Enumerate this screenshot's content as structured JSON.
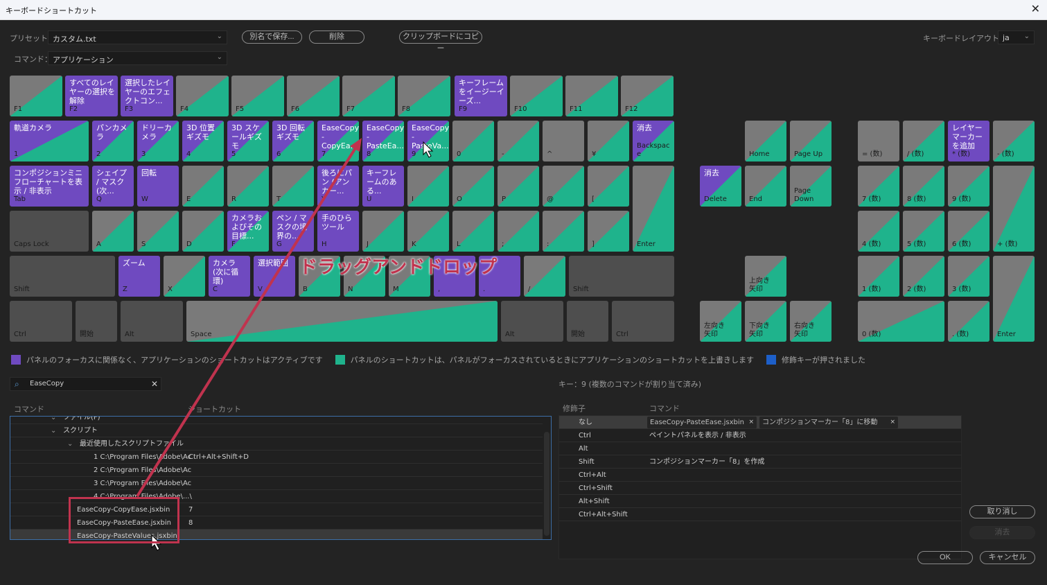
{
  "window": {
    "title": "キーボードショートカット",
    "close_icon": "✕"
  },
  "toolbar": {
    "preset_label": "プリセット：",
    "preset_value": "カスタム.txt",
    "command_label": "コマンド：",
    "command_value": "アプリケーション",
    "save_as_label": "別名で保存...",
    "delete_label": "削除",
    "copy_clipboard_label": "クリップボードにコピー",
    "layout_label": "キーボードレイアウト：",
    "layout_value": "ja"
  },
  "colors": {
    "app_shortcut": "#6f4ac0",
    "panel_shortcut": "#1fb38c",
    "modifier": "#1d5fc9",
    "unassigned": "#7a7a7a",
    "modifier_key": "#4e4e4e",
    "annotation": "#c0334e"
  },
  "keys": [
    {
      "id": "F1",
      "label": "F1",
      "cmd": "",
      "type": "split"
    },
    {
      "id": "F2",
      "label": "F2",
      "cmd": "すべてのレイヤーの選択を解除",
      "type": "app"
    },
    {
      "id": "F3",
      "label": "F3",
      "cmd": "選択したレイヤーのエフェクトコン...",
      "type": "app"
    },
    {
      "id": "F4",
      "label": "F4",
      "cmd": "",
      "type": "split"
    },
    {
      "id": "F5",
      "label": "F5",
      "cmd": "",
      "type": "split"
    },
    {
      "id": "F6",
      "label": "F6",
      "cmd": "",
      "type": "split"
    },
    {
      "id": "F7",
      "label": "F7",
      "cmd": "",
      "type": "split"
    },
    {
      "id": "F8",
      "label": "F8",
      "cmd": "",
      "type": "split"
    },
    {
      "id": "F9",
      "label": "F9",
      "cmd": "キーフレームをイージーイーズ...",
      "type": "app"
    },
    {
      "id": "F10",
      "label": "F10",
      "cmd": "",
      "type": "split"
    },
    {
      "id": "F11",
      "label": "F11",
      "cmd": "",
      "type": "split"
    },
    {
      "id": "F12",
      "label": "F12",
      "cmd": "",
      "type": "split"
    },
    {
      "id": "1",
      "label": "1",
      "cmd": "軌道カメラ",
      "type": "appsplit"
    },
    {
      "id": "2",
      "label": "2",
      "cmd": "パンカメラ",
      "type": "appsplit"
    },
    {
      "id": "3",
      "label": "3",
      "cmd": "ドリーカメラ",
      "type": "appsplit"
    },
    {
      "id": "4",
      "label": "4",
      "cmd": "3D 位置ギズモ",
      "type": "appsplit"
    },
    {
      "id": "5",
      "label": "5",
      "cmd": "3D スケールギズモ",
      "type": "appsplit"
    },
    {
      "id": "6",
      "label": "6",
      "cmd": "3D 回転ギズモ",
      "type": "appsplit"
    },
    {
      "id": "7",
      "label": "7",
      "cmd": "EaseCopy\n-\nCopyEa...",
      "type": "appsplit"
    },
    {
      "id": "8",
      "label": "8",
      "cmd": "EaseCopy\n-\nPasteEa...",
      "type": "appsplit"
    },
    {
      "id": "9",
      "label": "9",
      "cmd": "EaseCopy\n-\nPasteVa...",
      "type": "appsplit"
    },
    {
      "id": "0",
      "label": "0",
      "cmd": "",
      "type": "split"
    },
    {
      "id": "minus",
      "label": "-",
      "cmd": "",
      "type": "split"
    },
    {
      "id": "caret",
      "label": "^",
      "cmd": "",
      "type": "unassigned"
    },
    {
      "id": "yen",
      "label": "¥",
      "cmd": "",
      "type": "split"
    },
    {
      "id": "Backspace",
      "label": "Backspac\ne",
      "cmd": "消去",
      "type": "appsplit"
    },
    {
      "id": "Tab",
      "label": "Tab",
      "cmd": "コンポジションミニフローチャートを表示 / 非表示",
      "type": "app"
    },
    {
      "id": "Q",
      "label": "Q",
      "cmd": "シェイプ / マスク (次...",
      "type": "app"
    },
    {
      "id": "W",
      "label": "W",
      "cmd": "回転",
      "type": "app"
    },
    {
      "id": "E",
      "label": "E",
      "cmd": "",
      "type": "split"
    },
    {
      "id": "R",
      "label": "R",
      "cmd": "",
      "type": "split"
    },
    {
      "id": "T",
      "label": "T",
      "cmd": "",
      "type": "split"
    },
    {
      "id": "Y",
      "label": "Y",
      "cmd": "後ろにパン (アンカー...",
      "type": "app"
    },
    {
      "id": "U",
      "label": "U",
      "cmd": "キーフレームのある...",
      "type": "app"
    },
    {
      "id": "I",
      "label": "I",
      "cmd": "",
      "type": "split"
    },
    {
      "id": "O",
      "label": "O",
      "cmd": "",
      "type": "split"
    },
    {
      "id": "P",
      "label": "P",
      "cmd": "",
      "type": "split"
    },
    {
      "id": "at",
      "label": "@",
      "cmd": "",
      "type": "split"
    },
    {
      "id": "lbracket",
      "label": "[",
      "cmd": "",
      "type": "split"
    },
    {
      "id": "Enter",
      "label": "Enter",
      "cmd": "",
      "type": "split"
    },
    {
      "id": "CapsLock",
      "label": "Caps Lock",
      "cmd": "",
      "type": "modifier"
    },
    {
      "id": "A",
      "label": "A",
      "cmd": "",
      "type": "split"
    },
    {
      "id": "S",
      "label": "S",
      "cmd": "",
      "type": "split"
    },
    {
      "id": "D",
      "label": "D",
      "cmd": "",
      "type": "split"
    },
    {
      "id": "F",
      "label": "F",
      "cmd": "カメラおよびその目標...",
      "type": "appsplit"
    },
    {
      "id": "G",
      "label": "G",
      "cmd": "ペン / マスクの境界の...",
      "type": "app"
    },
    {
      "id": "H",
      "label": "H",
      "cmd": "手のひらツール",
      "type": "app"
    },
    {
      "id": "J",
      "label": "J",
      "cmd": "",
      "type": "split"
    },
    {
      "id": "K",
      "label": "K",
      "cmd": "",
      "type": "split"
    },
    {
      "id": "L",
      "label": "L",
      "cmd": "",
      "type": "split"
    },
    {
      "id": "semicolon",
      "label": ";",
      "cmd": "",
      "type": "split"
    },
    {
      "id": "colon",
      "label": ":",
      "cmd": "",
      "type": "split"
    },
    {
      "id": "rbracket",
      "label": "]",
      "cmd": "",
      "type": "split"
    },
    {
      "id": "ShiftL",
      "label": "Shift",
      "cmd": "",
      "type": "modifier"
    },
    {
      "id": "Z",
      "label": "Z",
      "cmd": "ズーム",
      "type": "app"
    },
    {
      "id": "X",
      "label": "X",
      "cmd": "",
      "type": "split"
    },
    {
      "id": "C",
      "label": "C",
      "cmd": "カメラ (次に循環)",
      "type": "app"
    },
    {
      "id": "V",
      "label": "V",
      "cmd": "選択範囲",
      "type": "app"
    },
    {
      "id": "B",
      "label": "B",
      "cmd": "",
      "type": "split"
    },
    {
      "id": "N",
      "label": "N",
      "cmd": "",
      "type": "split"
    },
    {
      "id": "M",
      "label": "M",
      "cmd": "",
      "type": "split"
    },
    {
      "id": "comma",
      "label": ",",
      "cmd": "",
      "type": "app"
    },
    {
      "id": "period",
      "label": ".",
      "cmd": "",
      "type": "app"
    },
    {
      "id": "slash",
      "label": "/",
      "cmd": "",
      "type": "split"
    },
    {
      "id": "ShiftR",
      "label": "Shift",
      "cmd": "",
      "type": "modifier"
    },
    {
      "id": "CtrlL",
      "label": "Ctrl",
      "cmd": "",
      "type": "modifier"
    },
    {
      "id": "WinL",
      "label": "開始",
      "cmd": "",
      "type": "modifier"
    },
    {
      "id": "AltL",
      "label": "Alt",
      "cmd": "",
      "type": "modifier"
    },
    {
      "id": "Space",
      "label": "Space",
      "cmd": "",
      "type": "split"
    },
    {
      "id": "AltR",
      "label": "Alt",
      "cmd": "",
      "type": "modifier"
    },
    {
      "id": "WinR",
      "label": "開始",
      "cmd": "",
      "type": "modifier"
    },
    {
      "id": "CtrlR",
      "label": "Ctrl",
      "cmd": "",
      "type": "modifier"
    },
    {
      "id": "Home",
      "label": "Home",
      "cmd": "",
      "type": "split"
    },
    {
      "id": "PageUp",
      "label": "Page Up",
      "cmd": "",
      "type": "split"
    },
    {
      "id": "Delete",
      "label": "Delete",
      "cmd": "消去",
      "type": "appsplit"
    },
    {
      "id": "End",
      "label": "End",
      "cmd": "",
      "type": "split"
    },
    {
      "id": "PageDown",
      "label": "Page\nDown",
      "cmd": "",
      "type": "split"
    },
    {
      "id": "Up",
      "label": "上向き\n矢印",
      "cmd": "",
      "type": "split"
    },
    {
      "id": "Left",
      "label": "左向き\n矢印",
      "cmd": "",
      "type": "split"
    },
    {
      "id": "Down",
      "label": "下向き\n矢印",
      "cmd": "",
      "type": "split"
    },
    {
      "id": "Right",
      "label": "右向き\n矢印",
      "cmd": "",
      "type": "split"
    },
    {
      "id": "NumEq",
      "label": "= (数)",
      "cmd": "",
      "type": "unassigned"
    },
    {
      "id": "NumDiv",
      "label": "/ (数)",
      "cmd": "",
      "type": "split"
    },
    {
      "id": "NumMul",
      "label": "* (数)",
      "cmd": "レイヤーマーカーを追加",
      "type": "app"
    },
    {
      "id": "NumSub",
      "label": "- (数)",
      "cmd": "",
      "type": "split"
    },
    {
      "id": "Num7",
      "label": "7 (数)",
      "cmd": "",
      "type": "split"
    },
    {
      "id": "Num8",
      "label": "8 (数)",
      "cmd": "",
      "type": "split"
    },
    {
      "id": "Num9",
      "label": "9 (数)",
      "cmd": "",
      "type": "split"
    },
    {
      "id": "NumAdd",
      "label": "+ (数)",
      "cmd": "",
      "type": "split"
    },
    {
      "id": "Num4",
      "label": "4 (数)",
      "cmd": "",
      "type": "split"
    },
    {
      "id": "Num5",
      "label": "5 (数)",
      "cmd": "",
      "type": "split"
    },
    {
      "id": "Num6",
      "label": "6 (数)",
      "cmd": "",
      "type": "split"
    },
    {
      "id": "Num1",
      "label": "1 (数)",
      "cmd": "",
      "type": "split"
    },
    {
      "id": "Num2",
      "label": "2 (数)",
      "cmd": "",
      "type": "split"
    },
    {
      "id": "Num3",
      "label": "3 (数)",
      "cmd": "",
      "type": "split"
    },
    {
      "id": "NumEnter",
      "label": "Enter",
      "cmd": "",
      "type": "split"
    },
    {
      "id": "Num0",
      "label": "0 (数)",
      "cmd": "",
      "type": "split"
    },
    {
      "id": "NumDot",
      "label": ". (数)",
      "cmd": "",
      "type": "split"
    }
  ],
  "legend": [
    {
      "color": "#6f4ac0",
      "text": "パネルのフォーカスに関係なく、アプリケーションのショートカットはアクティブです"
    },
    {
      "color": "#1fb38c",
      "text": "パネルのショートカットは、パネルがフォーカスされているときにアプリケーションのショートカットを上書きします"
    },
    {
      "color": "#1d5fc9",
      "text": "修飾キーが押されました"
    }
  ],
  "search": {
    "value": "EaseCopy",
    "clear_icon": "✕",
    "search_icon": "⌕"
  },
  "tree": {
    "col_command": "コマンド",
    "col_shortcut": "ショートカット",
    "rows": [
      {
        "text": "ファイル(F)",
        "shortcut": "",
        "indent": 1,
        "chevron": true,
        "selected": false
      },
      {
        "text": "スクリプト",
        "shortcut": "",
        "indent": 2,
        "chevron": true,
        "selected": false
      },
      {
        "text": "最近使用したスクリプトファイル",
        "shortcut": "",
        "indent": 3,
        "chevron": true,
        "selected": false
      },
      {
        "text": "1 C:\\Program Files\\Adobe\\Ac",
        "shortcut": "Ctrl+Alt+Shift+D",
        "indent": 4,
        "chevron": false,
        "selected": false
      },
      {
        "text": "2 C:\\Program Files\\Adobe\\Ac",
        "shortcut": "",
        "indent": 4,
        "chevron": false,
        "selected": false
      },
      {
        "text": "3 C:\\Program Files\\Adobe\\Ac",
        "shortcut": "",
        "indent": 4,
        "chevron": false,
        "selected": false
      },
      {
        "text": "4 C:\\Program Files\\Adobe\\...\\",
        "shortcut": "",
        "indent": 4,
        "chevron": false,
        "selected": false
      },
      {
        "text": "EaseCopy-CopyEase.jsxbin",
        "shortcut": "7",
        "indent": 5,
        "chevron": false,
        "selected": false
      },
      {
        "text": "EaseCopy-PasteEase.jsxbin",
        "shortcut": "8",
        "indent": 5,
        "chevron": false,
        "selected": false
      },
      {
        "text": "EaseCopy-PasteValues.jsxbin",
        "shortcut": "",
        "indent": 5,
        "chevron": false,
        "selected": true
      }
    ]
  },
  "key_info": "キー：9 (複数のコマンドが割り当て済み)",
  "modifiers": {
    "col_modifier": "修飾子",
    "col_command": "コマンド",
    "rows": [
      {
        "mod": "なし",
        "cmd": "",
        "chips": [
          "EaseCopy-PasteEase.jsxbin",
          "コンポジションマーカー「8」に移動"
        ],
        "selected": true
      },
      {
        "mod": "Ctrl",
        "cmd": "ペイントパネルを表示 / 非表示",
        "chips": [],
        "selected": false
      },
      {
        "mod": "Alt",
        "cmd": "",
        "chips": [],
        "selected": false
      },
      {
        "mod": "Shift",
        "cmd": "コンポジションマーカー「8」を作成",
        "chips": [],
        "selected": false
      },
      {
        "mod": "Ctrl+Alt",
        "cmd": "",
        "chips": [],
        "selected": false
      },
      {
        "mod": "Ctrl+Shift",
        "cmd": "",
        "chips": [],
        "selected": false
      },
      {
        "mod": "Alt+Shift",
        "cmd": "",
        "chips": [],
        "selected": false
      },
      {
        "mod": "Ctrl+Alt+Shift",
        "cmd": "",
        "chips": [],
        "selected": false
      }
    ]
  },
  "buttons": {
    "undo": "取り消し",
    "clear": "消去",
    "ok": "OK",
    "cancel": "キャンセル"
  },
  "annotation": {
    "text": "ドラッグアンドドロップ"
  }
}
